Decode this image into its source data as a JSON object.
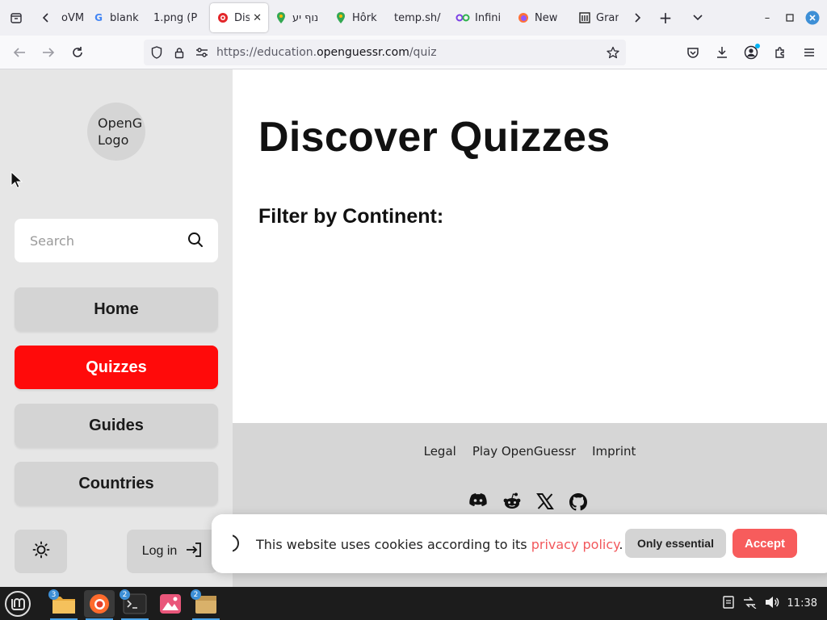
{
  "browser": {
    "tabs": [
      {
        "title": "oVM",
        "icon": "generic-tab-icon"
      },
      {
        "title": "blank",
        "icon": "google-icon"
      },
      {
        "title": "1.png (P",
        "icon": "none"
      },
      {
        "title": "Dis",
        "icon": "openguessr-icon",
        "active": true
      },
      {
        "title": "נוף יע",
        "icon": "google-maps-icon"
      },
      {
        "title": "Hôrk",
        "icon": "google-maps-icon"
      },
      {
        "title": "temp.sh/",
        "icon": "none"
      },
      {
        "title": "Infini",
        "icon": "infinity-icon"
      },
      {
        "title": "New",
        "icon": "firefox-icon"
      },
      {
        "title": "Grand",
        "icon": "museum-icon"
      }
    ],
    "url_prefix": "https://education.",
    "url_host": "openguessr.com",
    "url_path": "/quiz"
  },
  "sidebar": {
    "logo_text_line1": "OpenG",
    "logo_text_line2": "Logo",
    "search_placeholder": "Search",
    "nav": {
      "home": "Home",
      "quizzes": "Quizzes",
      "guides": "Guides",
      "countries": "Countries"
    },
    "login_label": "Log in"
  },
  "main": {
    "title": "Discover Quizzes",
    "filter_heading": "Filter by Continent:"
  },
  "footer": {
    "links": {
      "legal": "Legal",
      "play": "Play OpenGuessr",
      "imprint": "Imprint"
    }
  },
  "cookie_banner": {
    "text": "This website uses cookies according to its ",
    "link_text": "privacy policy",
    "text_end": ".",
    "only_essential": "Only essential",
    "accept": "Accept"
  },
  "taskbar": {
    "apps": [
      {
        "name": "files",
        "badge": "3"
      },
      {
        "name": "firefox",
        "badge": ""
      },
      {
        "name": "terminal",
        "badge": "2"
      },
      {
        "name": "image-viewer",
        "badge": ""
      },
      {
        "name": "archive",
        "badge": "2"
      }
    ],
    "clock": "11:38"
  },
  "colors": {
    "accent_red": "#ff0a0a",
    "accept_button": "#f75c5c",
    "privacy_link": "#f2585c"
  }
}
